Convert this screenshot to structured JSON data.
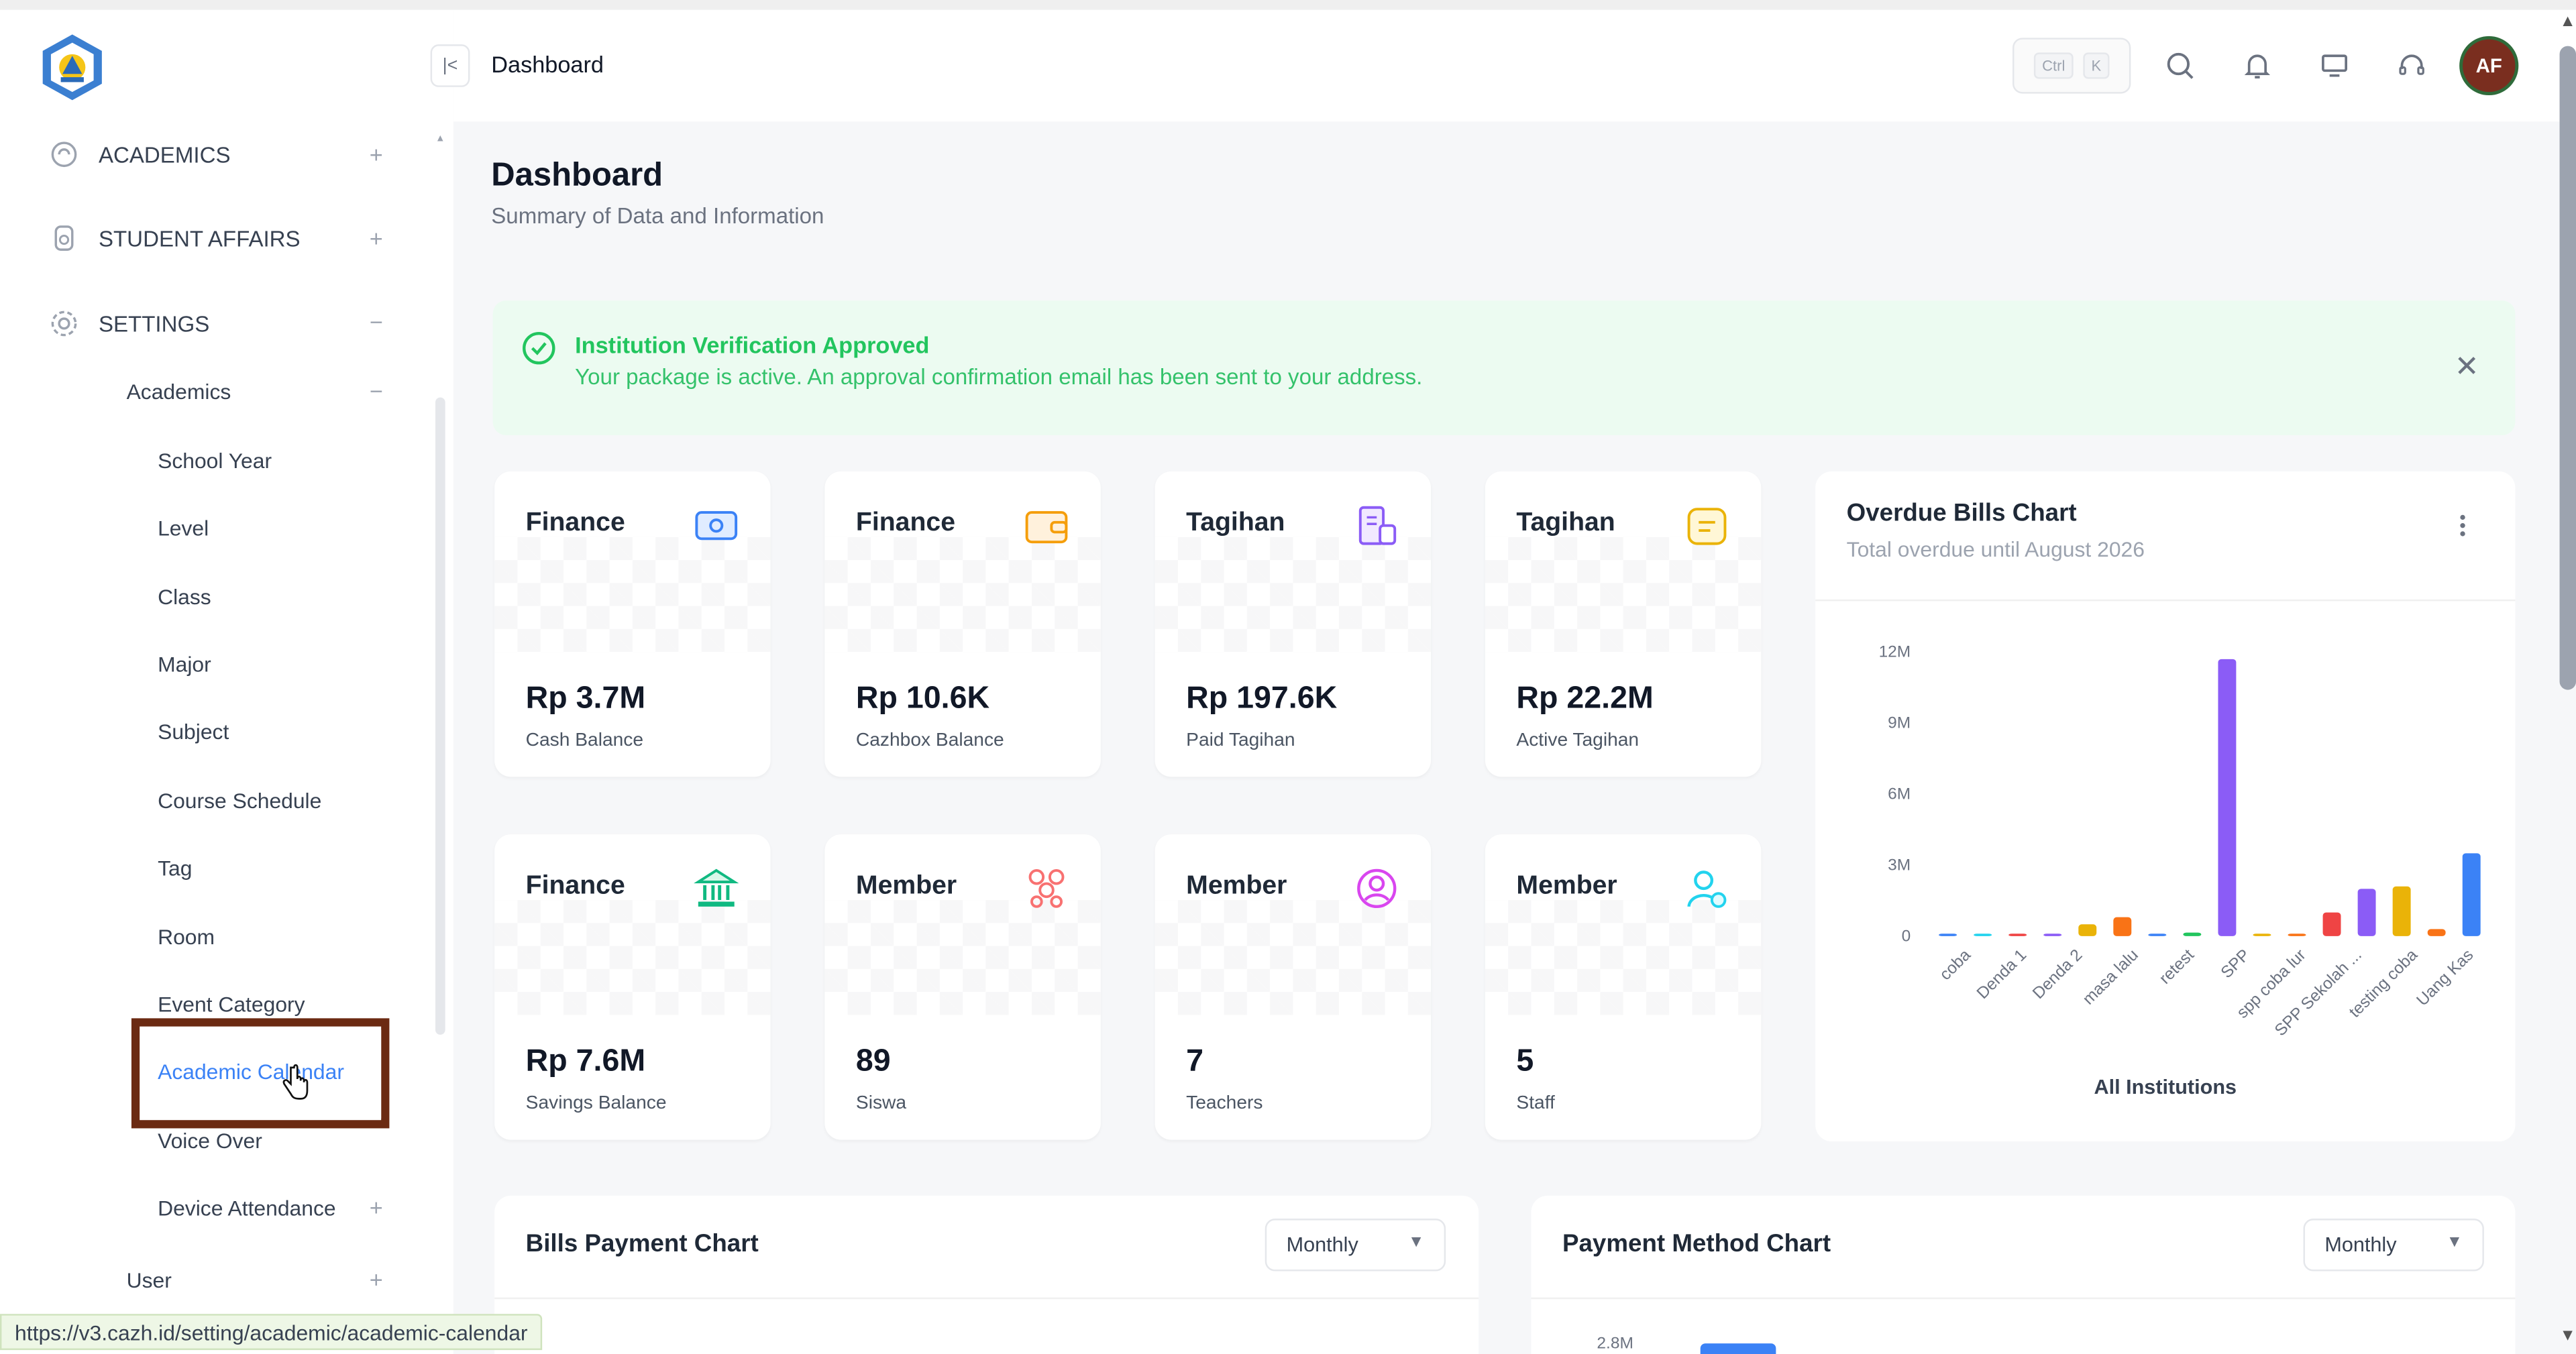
{
  "header": {
    "breadcrumb": "Dashboard",
    "shortcut_keys": [
      "Ctrl",
      "K"
    ],
    "avatar_initials": "AF",
    "icons": [
      "search-icon",
      "bell-icon",
      "monitor-icon",
      "headset-icon"
    ]
  },
  "sidebar": {
    "sections": [
      {
        "label": "ACADEMICS",
        "icon": "academics-icon",
        "toggle": "+"
      },
      {
        "label": "STUDENT AFFAIRS",
        "icon": "student-affairs-icon",
        "toggle": "+"
      },
      {
        "label": "SETTINGS",
        "icon": "gear-icon",
        "toggle": "−"
      }
    ],
    "settings_submenu": {
      "label": "Academics",
      "toggle": "−",
      "items": [
        "School Year",
        "Level",
        "Class",
        "Major",
        "Subject",
        "Course Schedule",
        "Tag",
        "Room",
        "Event Category",
        "Academic Calendar",
        "Voice Over",
        "Device Attendance"
      ],
      "device_attendance_toggle": "+",
      "active_item": "Academic Calendar"
    },
    "user_item": {
      "label": "User",
      "toggle": "+"
    }
  },
  "status_url": "https://v3.cazh.id/setting/academic/academic-calendar",
  "page": {
    "title": "Dashboard",
    "subtitle": "Summary of Data and Information"
  },
  "alert": {
    "title": "Institution Verification Approved",
    "message": "Your package is active. An approval confirmation email has been sent to your address.",
    "close": "✕"
  },
  "cards": [
    {
      "category": "Finance",
      "value": "Rp 3.7M",
      "label": "Cash Balance",
      "icon": "cash-icon",
      "color": "#3b82f6"
    },
    {
      "category": "Finance",
      "value": "Rp 10.6K",
      "label": "Cazhbox Balance",
      "icon": "wallet-icon",
      "color": "#f59e0b"
    },
    {
      "category": "Tagihan",
      "value": "Rp 197.6K",
      "label": "Paid Tagihan",
      "icon": "invoice-icon",
      "color": "#8b5cf6"
    },
    {
      "category": "Tagihan",
      "value": "Rp 22.2M",
      "label": "Active Tagihan",
      "icon": "note-icon",
      "color": "#eab308"
    },
    {
      "category": "Finance",
      "value": "Rp 7.6M",
      "label": "Savings Balance",
      "icon": "bank-icon",
      "color": "#10b981"
    },
    {
      "category": "Member",
      "value": "89",
      "label": "Siswa",
      "icon": "group-icon",
      "color": "#f87171"
    },
    {
      "category": "Member",
      "value": "7",
      "label": "Teachers",
      "icon": "user-circle-icon",
      "color": "#d946ef"
    },
    {
      "category": "Member",
      "value": "5",
      "label": "Staff",
      "icon": "staff-icon",
      "color": "#22d3ee"
    }
  ],
  "overdue_chart": {
    "title": "Overdue Bills Chart",
    "subtitle": "Total overdue until August 2026",
    "footer": "All Institutions",
    "menu_icon": "more-vertical-icon"
  },
  "chart_data": [
    {
      "type": "bar",
      "title": "Overdue Bills Chart",
      "subtitle": "Total overdue until August 2026",
      "xlabel": "All Institutions",
      "ylabel": "",
      "ylim": [
        0,
        12000000
      ],
      "yticks": [
        "0",
        "3M",
        "6M",
        "9M",
        "12M"
      ],
      "ytick_values": [
        0,
        3000000,
        6000000,
        9000000,
        12000000
      ],
      "categories": [
        "coba",
        "Denda 1",
        "Denda 2",
        "masa lalu",
        "retest",
        "SPP",
        "spp coba lur",
        "SPP Sekolah ...",
        "testing coba",
        "Uang Kas"
      ],
      "bars": [
        {
          "value": 100000,
          "color": "#3b82f6"
        },
        {
          "value": 50000,
          "color": "#22d3ee"
        },
        {
          "value": 60000,
          "color": "#ef4444"
        },
        {
          "value": 40000,
          "color": "#8b5cf6"
        },
        {
          "value": 500000,
          "color": "#eab308"
        },
        {
          "value": 800000,
          "color": "#f97316"
        },
        {
          "value": 40000,
          "color": "#3b82f6"
        },
        {
          "value": 150000,
          "color": "#22c55e"
        },
        {
          "value": 11700000,
          "color": "#8b5cf6"
        },
        {
          "value": 100000,
          "color": "#eab308"
        },
        {
          "value": 50000,
          "color": "#f97316"
        },
        {
          "value": 1000000,
          "color": "#ef4444"
        },
        {
          "value": 2000000,
          "color": "#8b5cf6"
        },
        {
          "value": 2100000,
          "color": "#eab308"
        },
        {
          "value": 300000,
          "color": "#f97316"
        },
        {
          "value": 3500000,
          "color": "#3b82f6"
        }
      ],
      "legend": "none",
      "grid": false
    },
    {
      "type": "bar",
      "title": "Payment Method Chart",
      "ylabel": "",
      "yticks_visible": [
        "2.8M"
      ],
      "categories": [],
      "values": [],
      "note": ""
    }
  ],
  "bills_payment_chart": {
    "title": "Bills Payment Chart",
    "select": "Monthly"
  },
  "payment_method_chart": {
    "title": "Payment Method Chart",
    "select": "Monthly",
    "visible_ytick": "2.8M"
  }
}
